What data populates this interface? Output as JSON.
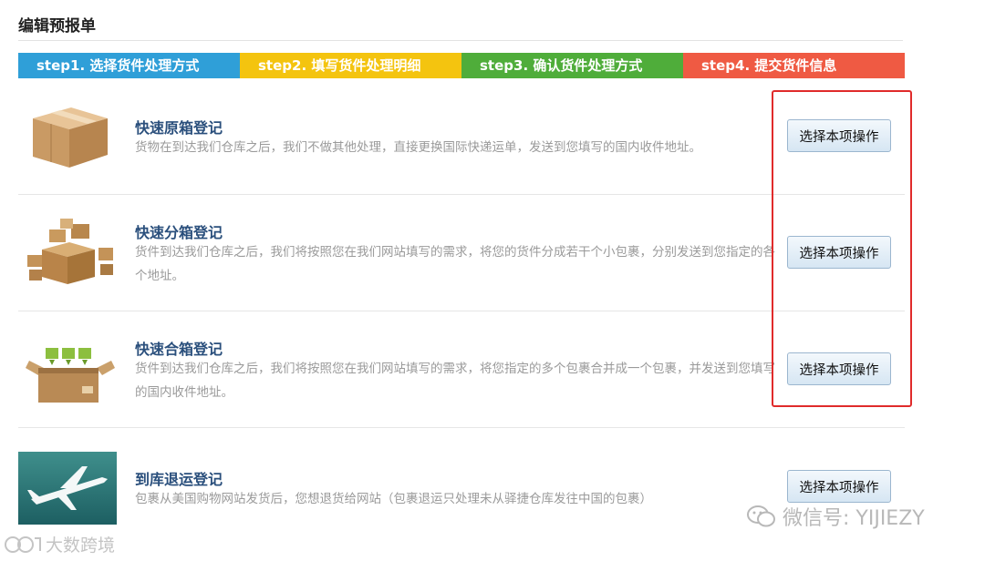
{
  "page_title": "编辑预报单",
  "steps": [
    {
      "label": "step1. 选择货件处理方式",
      "color": "#2f9fd8"
    },
    {
      "label": "step2. 填写货件处理明细",
      "color": "#f4c40f"
    },
    {
      "label": "step3. 确认货件处理方式",
      "color": "#4fad3a"
    },
    {
      "label": "step4. 提交货件信息",
      "color": "#ef5a43"
    }
  ],
  "options": [
    {
      "icon": "cardboard-box-icon",
      "title": "快速原箱登记",
      "description": "货物在到达我们仓库之后，我们不做其他处理，直接更换国际快递运单，发送到您填写的国内收件地址。",
      "button": "选择本项操作"
    },
    {
      "icon": "split-boxes-icon",
      "title": "快速分箱登记",
      "description": "货件到达我们仓库之后，我们将按照您在我们网站填写的需求，将您的货件分成若干个小包裹，分别发送到您指定的各个地址。",
      "button": "选择本项操作"
    },
    {
      "icon": "merge-boxes-icon",
      "title": "快速合箱登记",
      "description": "货件到达我们仓库之后，我们将按照您在我们网站填写的需求，将您指定的多个包裹合并成一个包裹，并发送到您填写的国内收件地址。",
      "button": "选择本项操作"
    },
    {
      "icon": "airplane-icon",
      "title": "到库退运登记",
      "description": "包裹从美国购物网站发货后，您想退货给网站（包裹退运只处理未从驿捷仓库发往中国的包裹）",
      "button": "选择本项操作"
    }
  ],
  "watermarks": {
    "wechat": "微信号: YIJIEZY",
    "bottom": "大数跨境"
  }
}
